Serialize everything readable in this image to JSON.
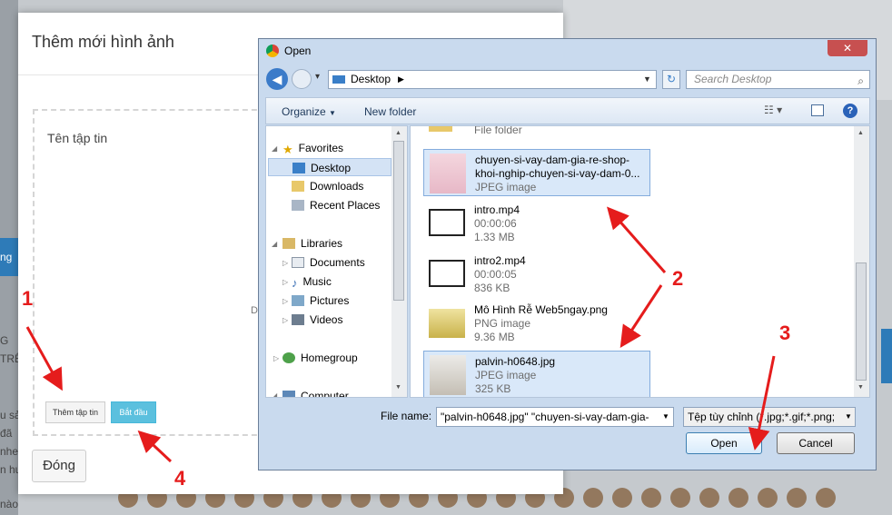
{
  "background": {
    "left_snippets": [
      "ng",
      "G",
      "TRÊ",
      "u sả",
      "đã",
      "nhe",
      "n hư",
      "nào"
    ],
    "blue_tab_label": "ng"
  },
  "modal": {
    "title": "Thêm mới hình ảnh",
    "field_label": "Tên tập tin",
    "hint_fragment": "Dr",
    "add_button": "Thêm tập tin",
    "start_button": "Bắt đầu",
    "close_button": "Đóng"
  },
  "dialog": {
    "title": "Open",
    "close_glyph": "✕",
    "address": "Desktop",
    "search_placeholder": "Search Desktop",
    "toolbar": {
      "organize": "Organize",
      "new_folder": "New folder"
    },
    "nav": {
      "favorites": "Favorites",
      "desktop": "Desktop",
      "downloads": "Downloads",
      "recent_places": "Recent Places",
      "libraries": "Libraries",
      "documents": "Documents",
      "music": "Music",
      "pictures": "Pictures",
      "videos": "Videos",
      "homegroup": "Homegroup",
      "computer": "Computer"
    },
    "files": {
      "partial_label": "File folder",
      "items": [
        {
          "name": "chuyen-si-vay-dam-gia-re-shop-khoi-nghip-chuyen-si-vay-dam-0...",
          "meta1": "JPEG image",
          "meta2": ""
        },
        {
          "name": "intro.mp4",
          "meta1": "00:00:06",
          "meta2": "1.33 MB"
        },
        {
          "name": "intro2.mp4",
          "meta1": "00:00:05",
          "meta2": "836 KB"
        },
        {
          "name": "Mô Hình Rễ Web5ngay.png",
          "meta1": "PNG image",
          "meta2": "9.36 MB"
        },
        {
          "name": "palvin-h0648.jpg",
          "meta1": "JPEG image",
          "meta2": "325 KB"
        }
      ]
    },
    "file_name_label": "File name:",
    "file_name_value": "\"palvin-h0648.jpg\" \"chuyen-si-vay-dam-gia-",
    "file_type_value": "Tệp tùy chỉnh (*.jpg;*.gif;*.png;",
    "open_button": "Open",
    "cancel_button": "Cancel"
  },
  "annotations": {
    "n1": "1",
    "n2": "2",
    "n3": "3",
    "n4": "4"
  },
  "colors": {
    "annotation_red": "#e51c1c",
    "selection_blue": "#d9e8f9",
    "start_button": "#5bc0de"
  }
}
